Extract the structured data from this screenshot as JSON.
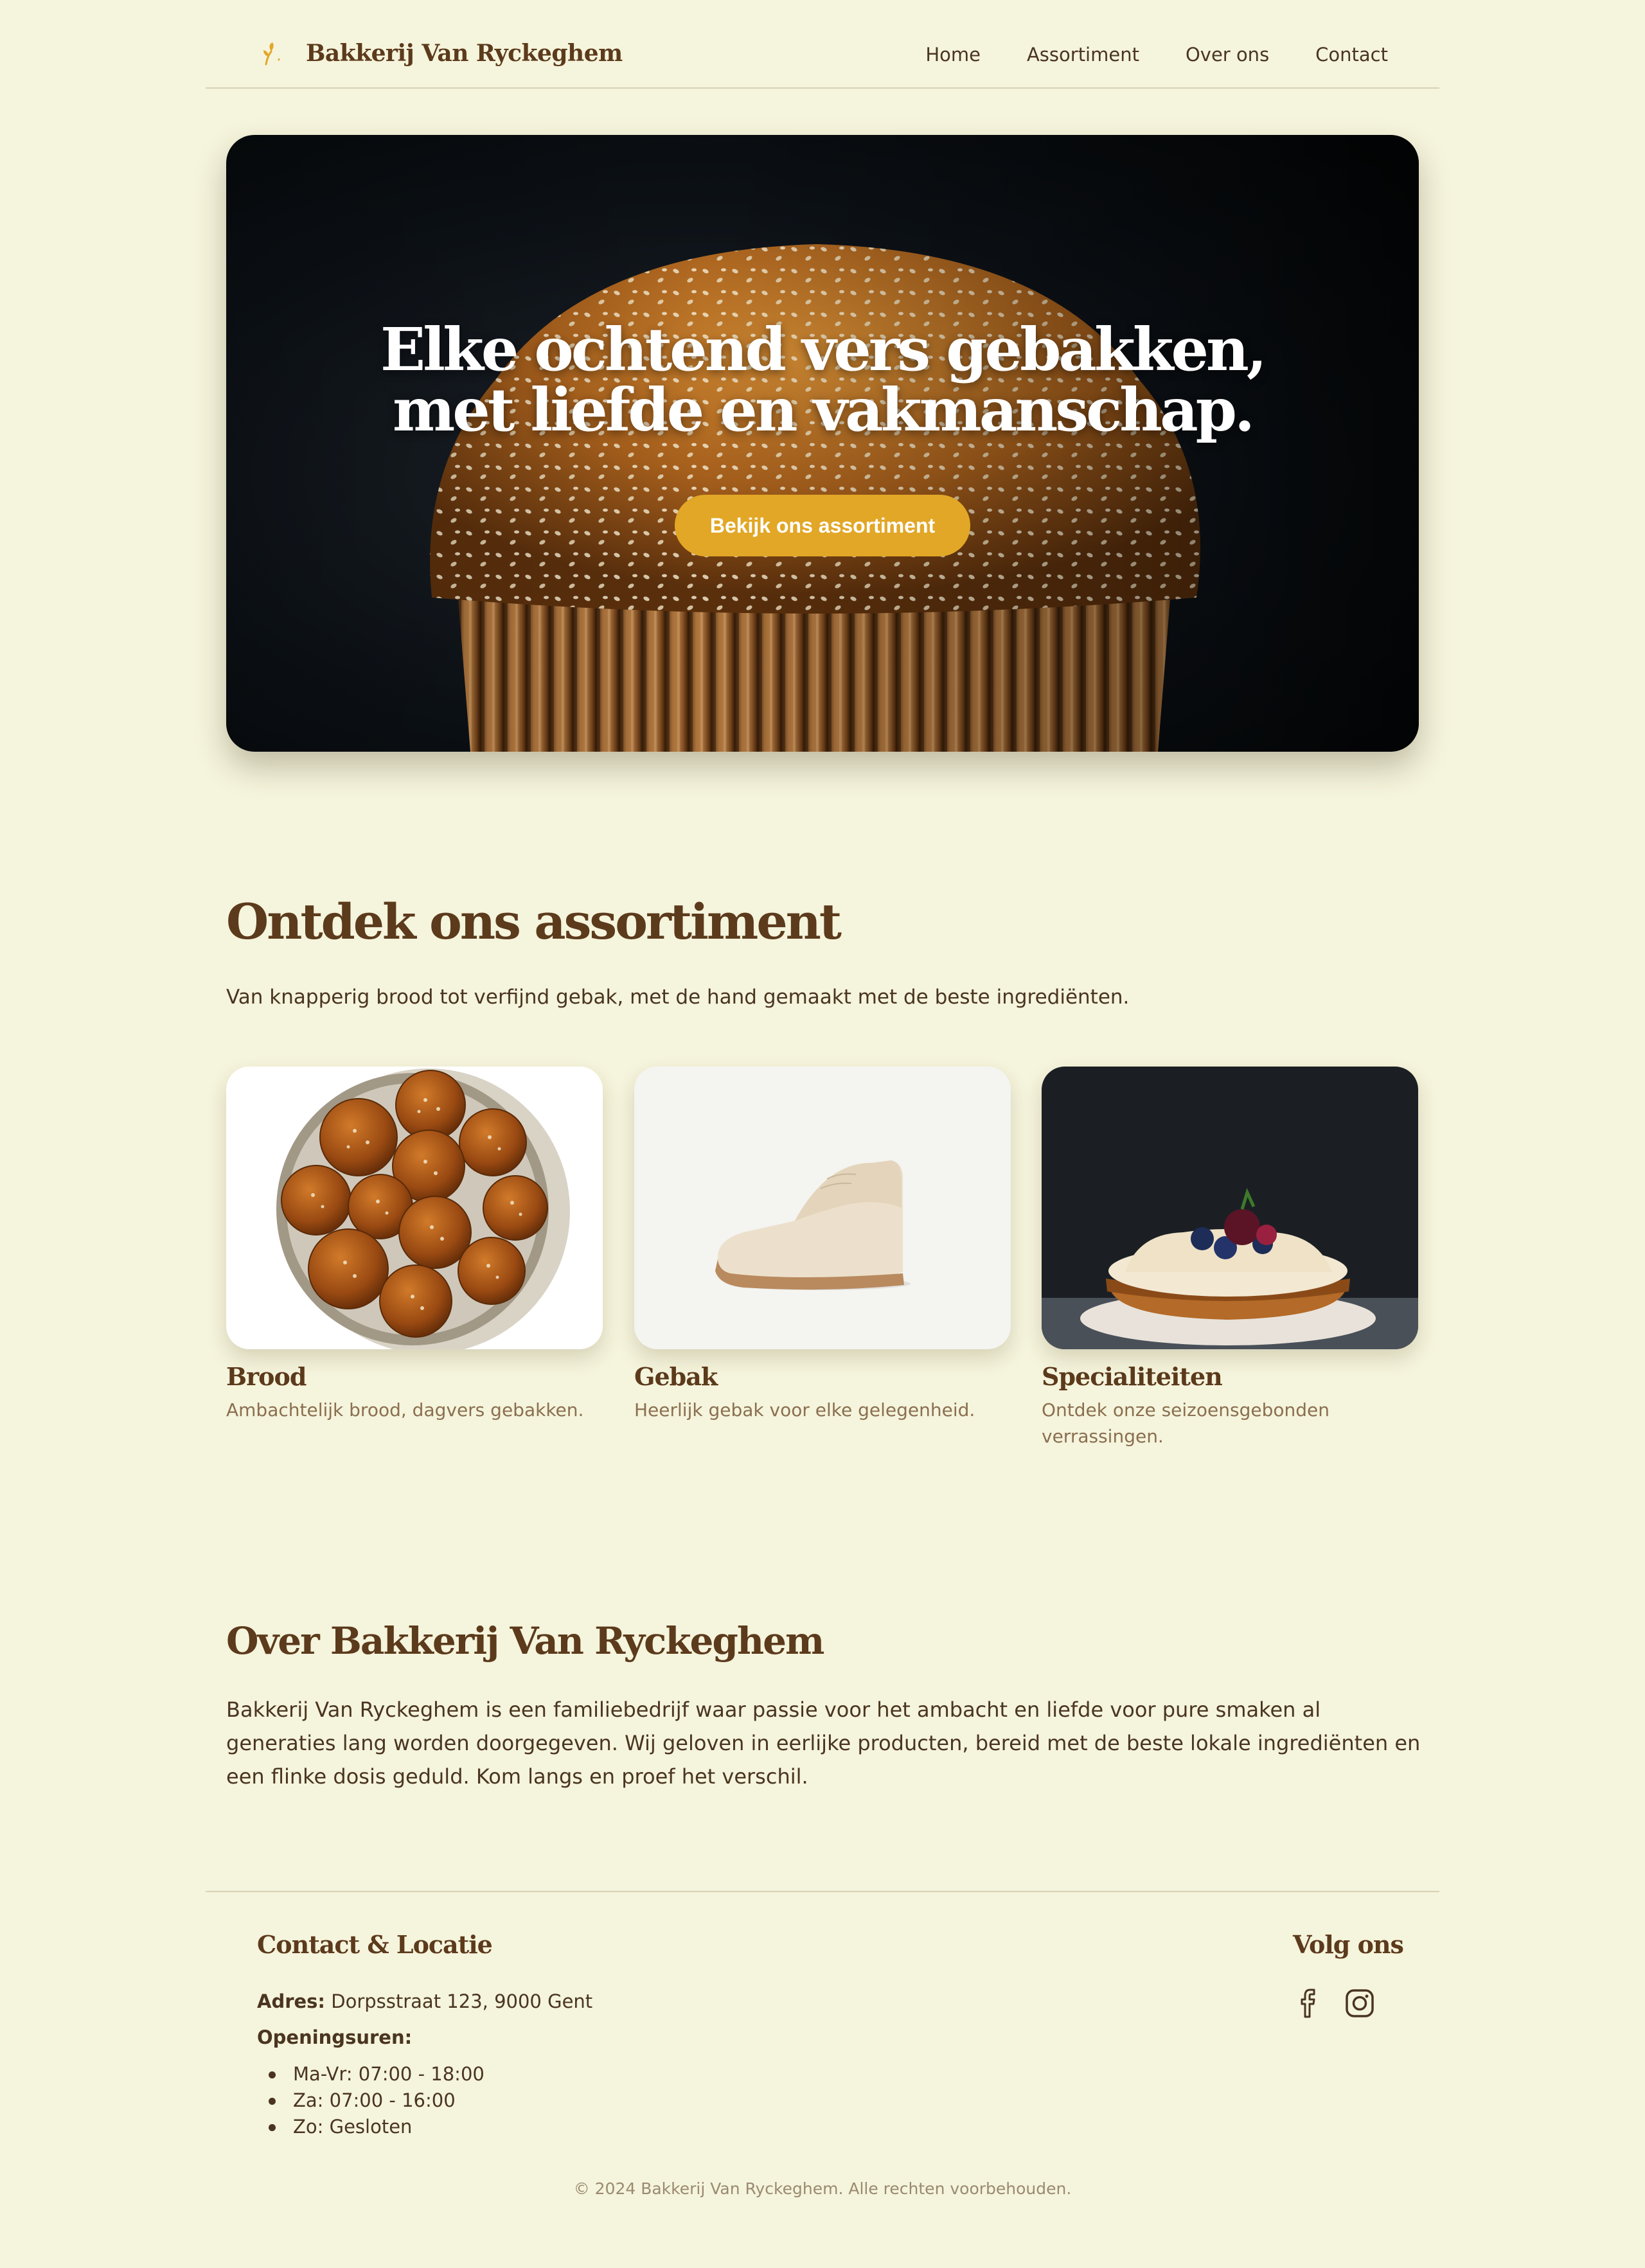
{
  "header": {
    "brand": "Bakkerij Van Ryckeghem",
    "nav": [
      "Home",
      "Assortiment",
      "Over ons",
      "Contact"
    ]
  },
  "hero": {
    "title_line1": "Elke ochtend vers gebakken,",
    "title_line2": "met liefde en vakmanschap.",
    "cta": "Bekijk ons assortiment"
  },
  "assortiment": {
    "title": "Ontdek ons assortiment",
    "subtitle": "Van knapperig brood tot verfijnd gebak, met de hand gemaakt met de beste ingrediënten.",
    "cards": [
      {
        "title": "Brood",
        "desc": "Ambachtelijk brood, dagvers gebakken."
      },
      {
        "title": "Gebak",
        "desc": "Heerlijk gebak voor elke gelegenheid."
      },
      {
        "title": "Specialiteiten",
        "desc": "Ontdek onze seizoensgebonden verrassingen."
      }
    ]
  },
  "over": {
    "title": "Over Bakkerij Van Ryckeghem",
    "text": "Bakkerij Van Ryckeghem is een familiebedrijf waar passie voor het ambacht en liefde voor pure smaken al generaties lang worden doorgegeven. Wij geloven in eerlijke producten, bereid met de beste lokale ingrediënten en een flinke dosis geduld. Kom langs en proef het verschil."
  },
  "footer": {
    "contact_title": "Contact & Locatie",
    "address_label": "Adres:",
    "address": "Dorpsstraat 123, 9000 Gent",
    "hours_label": "Openingsuren:",
    "hours": [
      "Ma-Vr: 07:00 - 18:00",
      "Za: 07:00 - 16:00",
      "Zo: Gesloten"
    ],
    "social_title": "Volg ons",
    "social_icons": [
      "facebook-icon",
      "instagram-icon"
    ],
    "copyright": "© 2024 Bakkerij Van Ryckeghem. Alle rechten voorbehouden."
  },
  "colors": {
    "background": "#f5f4dc",
    "brand_brown": "#5c3a1c",
    "accent_gold": "#e2a726",
    "text": "#4a3520"
  }
}
